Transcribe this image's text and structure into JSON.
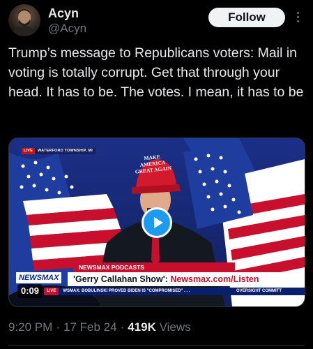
{
  "author": {
    "display_name": "Acyn",
    "handle": "@Acyn",
    "follow_label": "Follow",
    "more_icon": "more-vertical-icon"
  },
  "tweet": {
    "text": "Trump’s message to Republicans voters: Mail in voting is totally corrupt. Get that through your head. It has to be. The votes. I mean, it has to be"
  },
  "media": {
    "type": "video",
    "duration": "0:09",
    "play_icon": "play-icon",
    "accent_color": "#1d9bf0",
    "overlay": {
      "live_label": "LIVE",
      "location": "WATERFORD TOWNSHIP, MI",
      "hat_text_line1": "MAKE AMERICA",
      "hat_text_line2": "GREAT AGAIN",
      "segment_tag": "NEWSMAX PODCASTS",
      "network_logo": "NEWSMAX",
      "show_name": "'Gerry Callahan Show':",
      "show_url": "Newsmax.com/Listen",
      "ticker_live": "LIVE",
      "ticker_text": "WSMAX: BOBULINSKI PROVED BIDEN IS \"COMPROMISED\" . . .",
      "ticker_right": "OVERSIGHT COMMITT"
    }
  },
  "meta": {
    "time": "9:20 PM",
    "date": "17 Feb 24",
    "views_count": "419K",
    "views_label": "Views",
    "separator": "·"
  }
}
